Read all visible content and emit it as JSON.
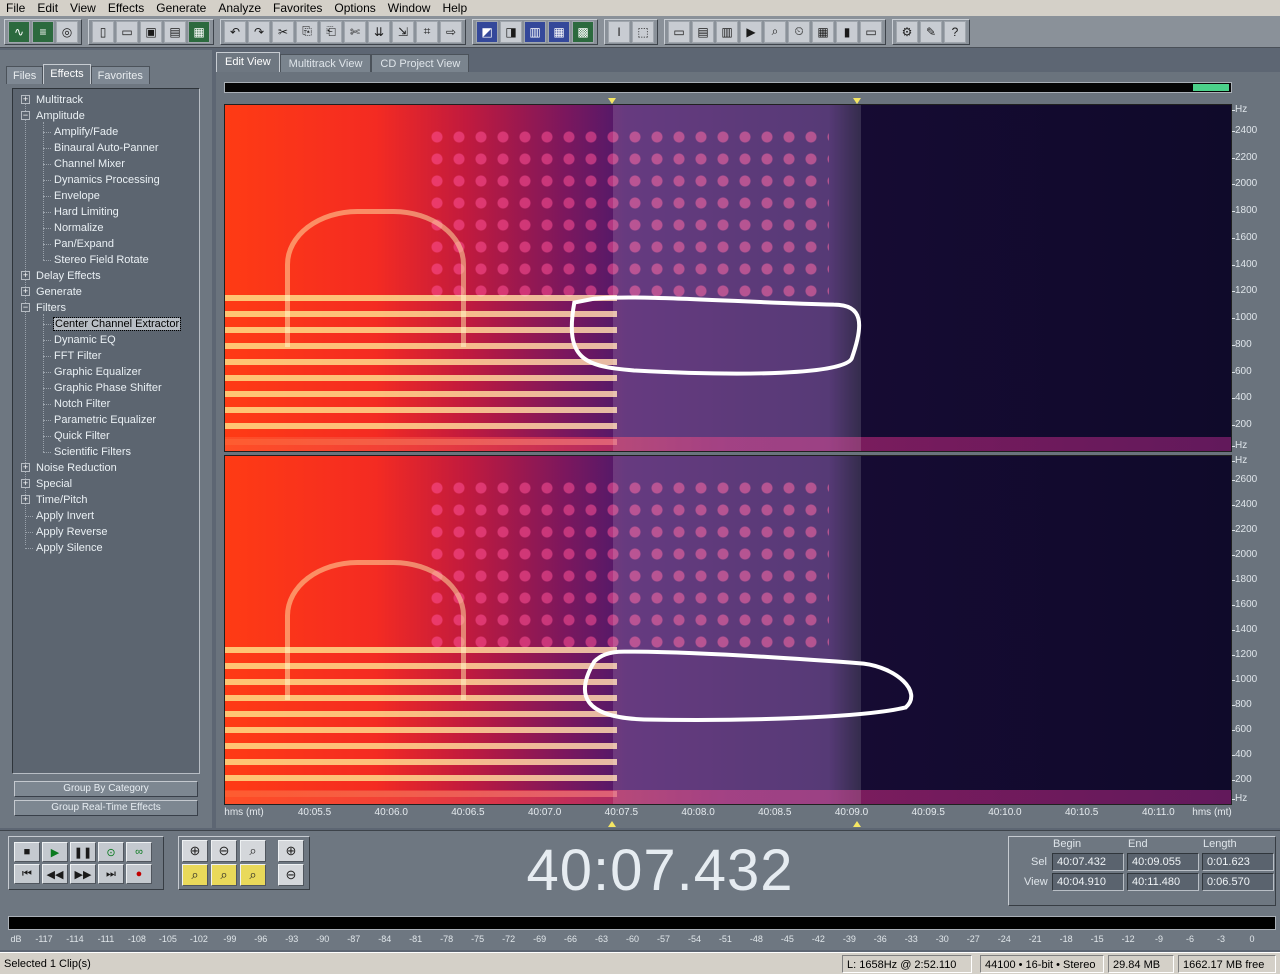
{
  "menu": [
    "File",
    "Edit",
    "View",
    "Effects",
    "Generate",
    "Analyze",
    "Favorites",
    "Options",
    "Window",
    "Help"
  ],
  "left_tabs": [
    "Files",
    "Effects",
    "Favorites"
  ],
  "active_left_tab": "Effects",
  "tree": [
    {
      "label": "Multitrack",
      "level": 0,
      "toggle": "+"
    },
    {
      "label": "Amplitude",
      "level": 0,
      "toggle": "-"
    },
    {
      "label": "Amplify/Fade",
      "level": 1
    },
    {
      "label": "Binaural Auto-Panner",
      "level": 1
    },
    {
      "label": "Channel Mixer",
      "level": 1
    },
    {
      "label": "Dynamics Processing",
      "level": 1
    },
    {
      "label": "Envelope",
      "level": 1
    },
    {
      "label": "Hard Limiting",
      "level": 1
    },
    {
      "label": "Normalize",
      "level": 1
    },
    {
      "label": "Pan/Expand",
      "level": 1
    },
    {
      "label": "Stereo Field Rotate",
      "level": 1
    },
    {
      "label": "Delay Effects",
      "level": 0,
      "toggle": "+"
    },
    {
      "label": "Generate",
      "level": 0,
      "toggle": "+"
    },
    {
      "label": "Filters",
      "level": 0,
      "toggle": "-"
    },
    {
      "label": "Center Channel Extractor",
      "level": 1,
      "selected": true
    },
    {
      "label": "Dynamic EQ",
      "level": 1
    },
    {
      "label": "FFT Filter",
      "level": 1
    },
    {
      "label": "Graphic Equalizer",
      "level": 1
    },
    {
      "label": "Graphic Phase Shifter",
      "level": 1
    },
    {
      "label": "Notch Filter",
      "level": 1
    },
    {
      "label": "Parametric Equalizer",
      "level": 1
    },
    {
      "label": "Quick Filter",
      "level": 1
    },
    {
      "label": "Scientific Filters",
      "level": 1
    },
    {
      "label": "Noise Reduction",
      "level": 0,
      "toggle": "+"
    },
    {
      "label": "Special",
      "level": 0,
      "toggle": "+"
    },
    {
      "label": "Time/Pitch",
      "level": 0,
      "toggle": "+"
    },
    {
      "label": "Apply Invert",
      "level": 0
    },
    {
      "label": "Apply Reverse",
      "level": 0
    },
    {
      "label": "Apply Silence",
      "level": 0
    }
  ],
  "left_buttons": {
    "group_by_category": "Group By Category",
    "group_realtime": "Group Real-Time Effects"
  },
  "view_tabs": [
    "Edit View",
    "Multitrack View",
    "CD Project View"
  ],
  "active_view_tab": "Edit View",
  "freq_axis_top": {
    "unit": "Hz",
    "ticks": [
      "2400",
      "2200",
      "2000",
      "1800",
      "1600",
      "1400",
      "1200",
      "1000",
      "800",
      "600",
      "400",
      "200"
    ]
  },
  "freq_axis_bottom": {
    "unit": "Hz",
    "ticks": [
      "2600",
      "2400",
      "2200",
      "2000",
      "1800",
      "1600",
      "1400",
      "1200",
      "1000",
      "800",
      "600",
      "400",
      "200"
    ]
  },
  "time_ruler": {
    "left_label": "hms (mt)",
    "right_label": "hms (mt)",
    "ticks": [
      "40:05.5",
      "40:06.0",
      "40:06.5",
      "40:07.0",
      "40:07.5",
      "40:08.0",
      "40:08.5",
      "40:09.0",
      "40:09.5",
      "40:10.0",
      "40:10.5",
      "40:11.0"
    ]
  },
  "time_display": "40:07.432",
  "selection": {
    "headers": {
      "begin": "Begin",
      "end": "End",
      "length": "Length"
    },
    "sel_label": "Sel",
    "view_label": "View",
    "sel": {
      "begin": "40:07.432",
      "end": "40:09.055",
      "length": "0:01.623"
    },
    "view": {
      "begin": "40:04.910",
      "end": "40:11.480",
      "length": "0:06.570"
    }
  },
  "meter_scale": [
    "dB",
    "-117",
    "-114",
    "-111",
    "-108",
    "-105",
    "-102",
    "-99",
    "-96",
    "-93",
    "-90",
    "-87",
    "-84",
    "-81",
    "-78",
    "-75",
    "-72",
    "-69",
    "-66",
    "-63",
    "-60",
    "-57",
    "-54",
    "-51",
    "-48",
    "-45",
    "-42",
    "-39",
    "-36",
    "-33",
    "-30",
    "-27",
    "-24",
    "-21",
    "-18",
    "-15",
    "-12",
    "-9",
    "-6",
    "-3",
    "0"
  ],
  "status": {
    "selected": "Selected 1 Clip(s)",
    "cursor": "L: 1658Hz @   2:52.110",
    "format": "44100 • 16-bit • Stereo",
    "size": "29.84 MB",
    "free": "1662.17 MB free"
  },
  "colors": {
    "panel": "#6e7781",
    "annotation": "#ffffff",
    "highlight_start": "#ff3b14",
    "dark_bg": "#0f0a2a"
  }
}
